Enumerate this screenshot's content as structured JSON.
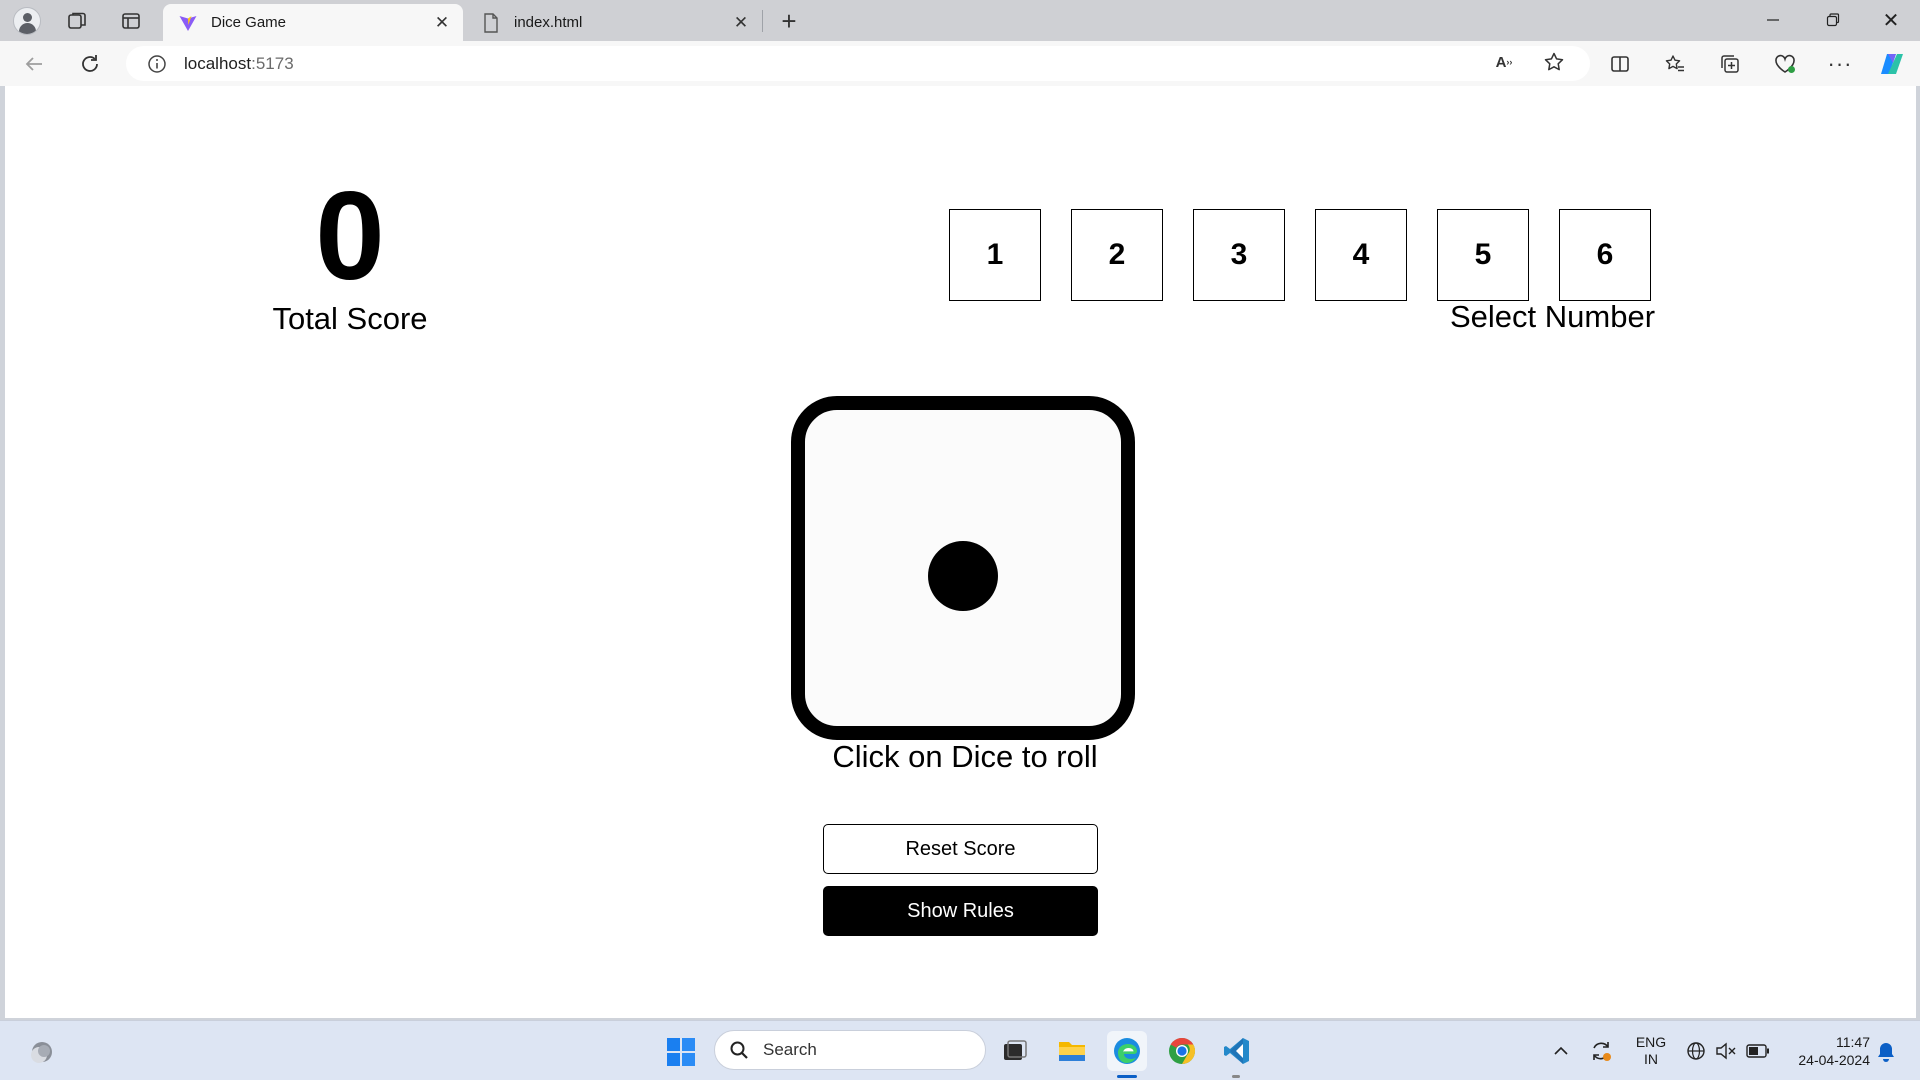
{
  "browser": {
    "tabs": [
      {
        "title": "Dice Game",
        "active": true
      },
      {
        "title": "index.html",
        "active": false
      }
    ],
    "address": {
      "host": "localhost",
      "port": ":5173"
    }
  },
  "game": {
    "total_score": "0",
    "total_score_label": "Total Score",
    "numbers": [
      "1",
      "2",
      "3",
      "4",
      "5",
      "6"
    ],
    "select_label": "Select Number",
    "dice_face": 1,
    "dice_hint": "Click on Dice to roll",
    "reset_label": "Reset Score",
    "rules_label": "Show Rules"
  },
  "taskbar": {
    "search_placeholder": "Search",
    "lang_top": "ENG",
    "lang_bottom": "IN",
    "time": "11:47",
    "date": "24-04-2024"
  },
  "colors": {
    "accent": "#0b5fc6",
    "page_bg": "#ffffff",
    "dice_border": "#000000",
    "rules_btn_bg": "#000000"
  }
}
